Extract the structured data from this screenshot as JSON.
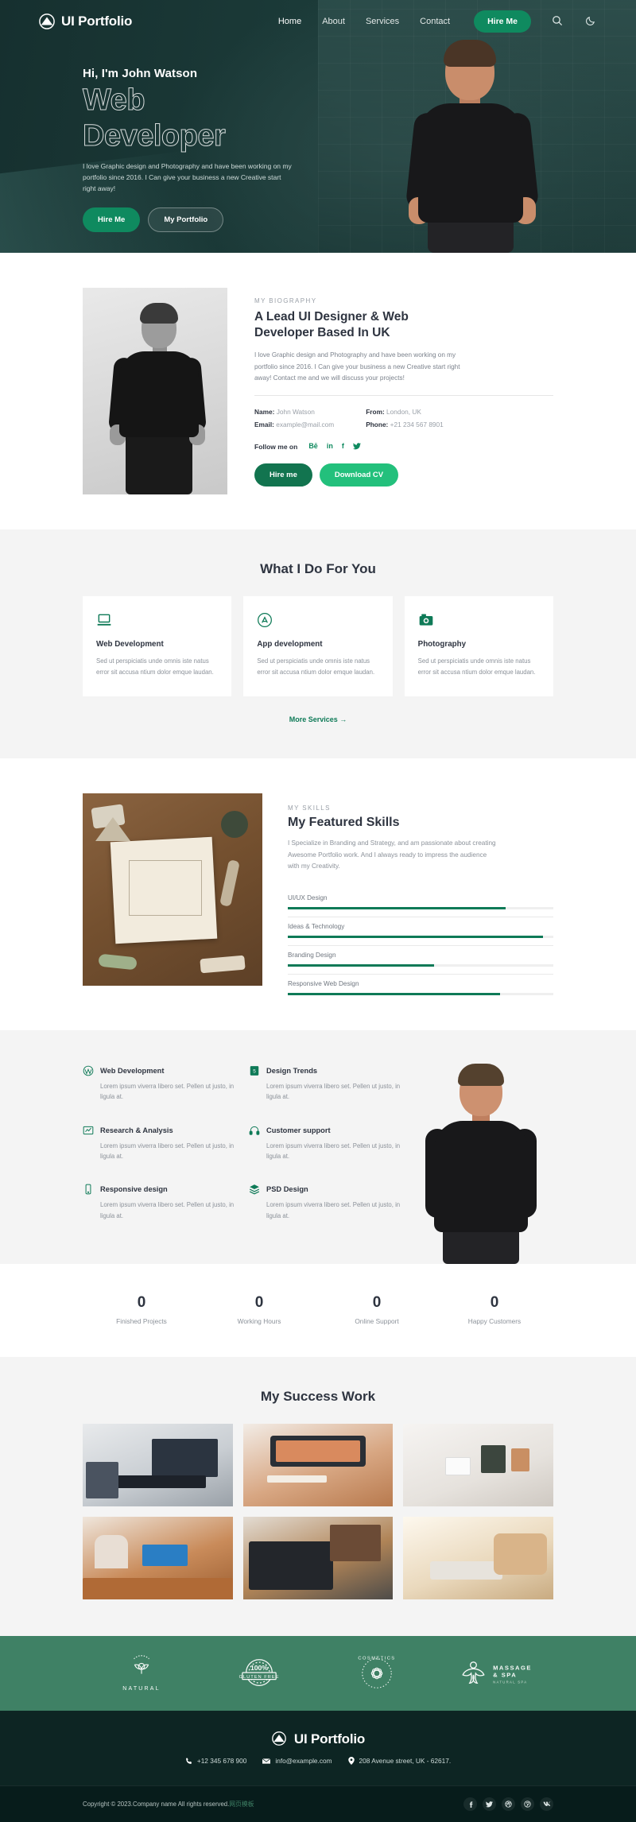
{
  "nav": {
    "brand": "UI Portfolio",
    "brand_icon": "mountain-logo-icon",
    "links": [
      {
        "label": "Home",
        "active": true
      },
      {
        "label": "About",
        "active": false
      },
      {
        "label": "Services",
        "active": false
      },
      {
        "label": "Contact",
        "active": false
      }
    ],
    "hire_label": "Hire Me",
    "search_icon": "search-icon",
    "theme_icon": "moon-icon"
  },
  "hero": {
    "greeting": "Hi, I'm John Watson",
    "title_line1": "Web",
    "title_line2": "Developer",
    "description": "I love Graphic design and Photography and have been working on my portfolio since 2016. I Can give your business a new Creative start right away!",
    "primary_btn": "Hire Me",
    "secondary_btn": "My Portfolio"
  },
  "biography": {
    "eyebrow": "MY BIOGRAPHY",
    "heading": "A Lead UI Designer & Web Developer Based In UK",
    "paragraph": "I love Graphic design and Photography and have been working on my portfolio since 2016. I Can give your business a new Creative start right away! Contact me and we will discuss your projects!",
    "facts_left": [
      {
        "label": "Name:",
        "value": "John Watson"
      },
      {
        "label": "Email:",
        "value": "example@mail.com"
      }
    ],
    "facts_right": [
      {
        "label": "From:",
        "value": "London, UK"
      },
      {
        "label": "Phone:",
        "value": "+21 234 567 8901"
      }
    ],
    "follow_label": "Follow me on",
    "socials": [
      "behance-icon",
      "linkedin-icon",
      "facebook-icon",
      "twitter-icon"
    ],
    "hire_btn": "Hire me",
    "cv_btn": "Download CV"
  },
  "services": {
    "title": "What I Do For You",
    "cards": [
      {
        "icon": "laptop-icon",
        "title": "Web Development",
        "text": "Sed ut perspiciatis unde omnis iste natus error sit accusa ntium dolor emque laudan."
      },
      {
        "icon": "appstore-icon",
        "title": "App development",
        "text": "Sed ut perspiciatis unde omnis iste natus error sit accusa ntium dolor emque laudan."
      },
      {
        "icon": "camera-icon",
        "title": "Photography",
        "text": "Sed ut perspiciatis unde omnis iste natus error sit accusa ntium dolor emque laudan."
      }
    ],
    "more_label": "More Services →"
  },
  "skills": {
    "eyebrow": "MY SKILLS",
    "heading": "My Featured Skills",
    "paragraph": "I Specialize in Branding and Strategy, and am passionate about creating Awesome Portfolio work. And I always ready to impress the audience with my Creativity.",
    "bars": [
      {
        "label": "UI/UX Design",
        "percent": 82
      },
      {
        "label": "Ideas & Technology",
        "percent": 96
      },
      {
        "label": "Branding Design",
        "percent": 55
      },
      {
        "label": "Responsive Web Design",
        "percent": 80
      }
    ]
  },
  "features": {
    "items": [
      {
        "icon": "wordpress-icon",
        "title": "Web Development",
        "text": "Lorem ipsum viverra libero set. Pellen ut justo, in ligula at."
      },
      {
        "icon": "html5-icon",
        "title": "Design Trends",
        "text": "Lorem ipsum viverra libero set. Pellen ut justo, in ligula at."
      },
      {
        "icon": "chart-icon",
        "title": "Research & Analysis",
        "text": "Lorem ipsum viverra libero set. Pellen ut justo, in ligula at."
      },
      {
        "icon": "headset-icon",
        "title": "Customer support",
        "text": "Lorem ipsum viverra libero set. Pellen ut justo, in ligula at."
      },
      {
        "icon": "mobile-icon",
        "title": "Responsive design",
        "text": "Lorem ipsum viverra libero set. Pellen ut justo, in ligula at."
      },
      {
        "icon": "layers-icon",
        "title": "PSD Design",
        "text": "Lorem ipsum viverra libero set. Pellen ut justo, in ligula at."
      }
    ]
  },
  "counters": [
    {
      "number": "0",
      "label": "Finished Projects"
    },
    {
      "number": "0",
      "label": "Working Hours"
    },
    {
      "number": "0",
      "label": "Online Support"
    },
    {
      "number": "0",
      "label": "Happy Customers"
    }
  ],
  "portfolio": {
    "title": "My Success Work",
    "items": [
      {
        "alt": "imac-desk-workspace"
      },
      {
        "alt": "curved-monitor-desk"
      },
      {
        "alt": "white-shelf-vase-desk"
      },
      {
        "alt": "woman-working-laptop"
      },
      {
        "alt": "hands-typing-macbook"
      },
      {
        "alt": "hands-keyboard-sunlight"
      }
    ]
  },
  "brands": [
    {
      "icon": "natural-leaf-badge",
      "text": "NATURAL"
    },
    {
      "icon": "gluten-free-badge",
      "text": "100% GLUTEN FREE"
    },
    {
      "icon": "cosmetics-flower-badge",
      "text": "COSMETICS"
    },
    {
      "icon": "massage-spa-badge",
      "text": "MASSAGE & SPA"
    }
  ],
  "footer": {
    "brand": "UI Portfolio",
    "phone": "+12 345 678 900",
    "email": "info@example.com",
    "address": "208 Avenue street, UK - 62617.",
    "copyright": "Copyright © 2023.Company name All rights reserved.",
    "copyright_link": "网页模板",
    "socials": [
      "facebook-icon",
      "twitter-icon",
      "dribbble-icon",
      "pinterest-icon",
      "vk-icon"
    ]
  },
  "colors": {
    "accent": "#0e7a57",
    "accent_bright": "#23c07c",
    "hero_bg": "#1b3a38",
    "brand_strip": "#3f8165",
    "footer_bg": "#0d2523",
    "footer_bar": "#071c1b"
  }
}
